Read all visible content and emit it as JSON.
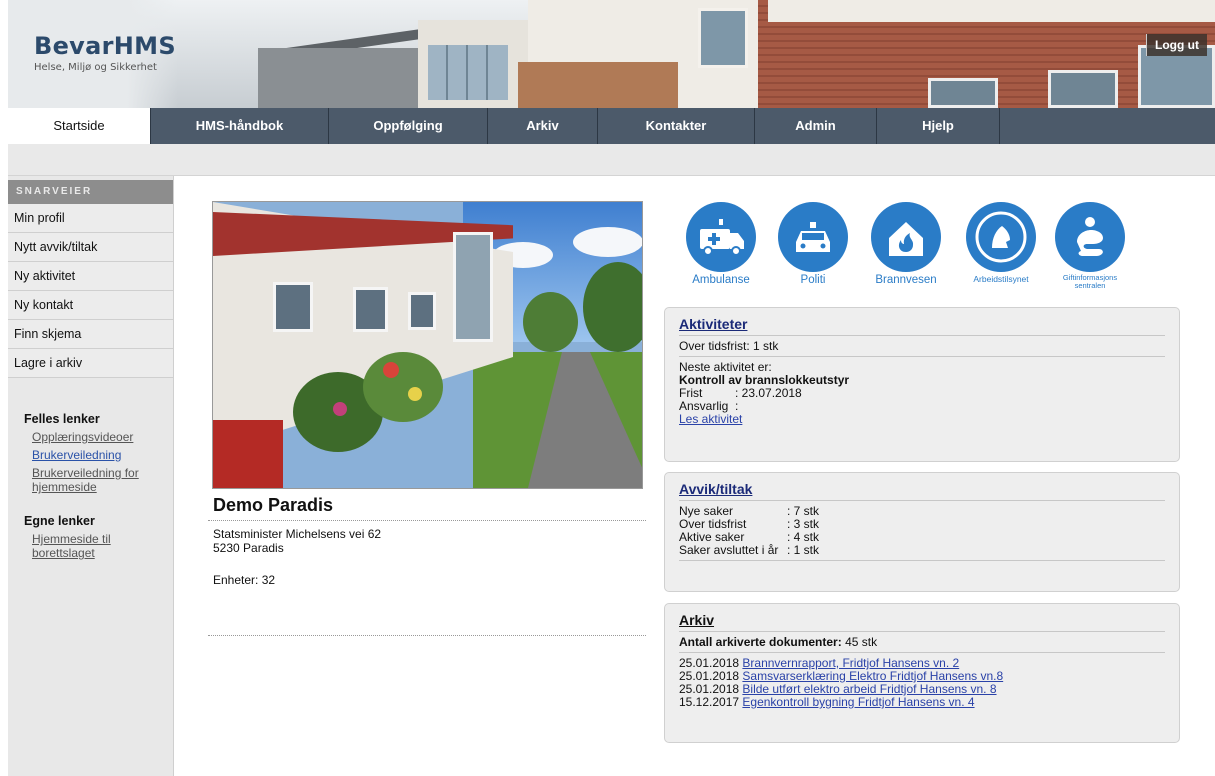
{
  "header": {
    "logo_title": "BevarHMS",
    "logo_subtitle": "Helse, Miljø og Sikkerhet",
    "logout_label": "Logg ut"
  },
  "nav": {
    "items": [
      {
        "label": "Startside",
        "active": true
      },
      {
        "label": "HMS-håndbok",
        "active": false
      },
      {
        "label": "Oppfølging",
        "active": false
      },
      {
        "label": "Arkiv",
        "active": false
      },
      {
        "label": "Kontakter",
        "active": false
      },
      {
        "label": "Admin",
        "active": false
      },
      {
        "label": "Hjelp",
        "active": false
      }
    ]
  },
  "sidebar": {
    "header": "SNARVEIER",
    "links": [
      "Min profil",
      "Nytt avvik/tiltak",
      "Ny aktivitet",
      "Ny kontakt",
      "Finn skjema",
      "Lagre i arkiv"
    ],
    "shared_links_title": "Felles lenker",
    "shared_links": [
      "Opplæringsvideoer",
      "Brukerveiledning",
      "Brukerveiledning for hjemmeside"
    ],
    "own_links_title": "Egne lenker",
    "own_links": [
      "Hjemmeside til borettslaget"
    ]
  },
  "property": {
    "name": "Demo Paradis",
    "address_line1": "Statsminister Michelsens vei 62",
    "address_line2": "5230 Paradis",
    "units": "Enheter: 32"
  },
  "emergency": {
    "ambulance": "Ambulanse",
    "police": "Politi",
    "fire": "Brannvesen",
    "labour": "Arbeidstilsynet",
    "poison": "Giftinformasjons sentralen"
  },
  "activities": {
    "title": "Aktiviteter",
    "overdue": "Over tidsfrist: 1 stk",
    "next_label": "Neste aktivitet er:",
    "next_name": "Kontroll av brannslokkeutstyr",
    "deadline_key": "Frist",
    "deadline_value": ": 23.07.2018",
    "responsible_key": "Ansvarlig",
    "responsible_value": ":",
    "read_link": "Les aktivitet"
  },
  "deviations": {
    "title": "Avvik/tiltak",
    "rows": [
      {
        "key": "Nye saker",
        "value": ": 7 stk"
      },
      {
        "key": "Over tidsfrist",
        "value": ": 3 stk"
      },
      {
        "key": "Aktive saker",
        "value": ": 4 stk"
      },
      {
        "key": "Saker avsluttet i år",
        "value": ": 1 stk"
      }
    ]
  },
  "archive": {
    "title": "Arkiv",
    "count_label": "Antall arkiverte dokumenter:",
    "count_value": "45 stk",
    "docs": [
      {
        "date": "25.01.2018",
        "name": "Brannvernrapport, Fridtjof Hansens vn. 2"
      },
      {
        "date": "25.01.2018",
        "name": "Samsvarserklæring Elektro Fridtjof Hansens vn.8"
      },
      {
        "date": "25.01.2018",
        "name": "Bilde utført elektro arbeid Fridtjof Hansens vn. 8"
      },
      {
        "date": "15.12.2017",
        "name": "Egenkontroll bygning Fridtjof Hansens vn. 4"
      }
    ]
  },
  "colors": {
    "nav_bg": "#4c5a6a",
    "emergency_blue": "#2a7cc7",
    "panel_title": "#1b2a78",
    "link": "#2a42a8"
  }
}
